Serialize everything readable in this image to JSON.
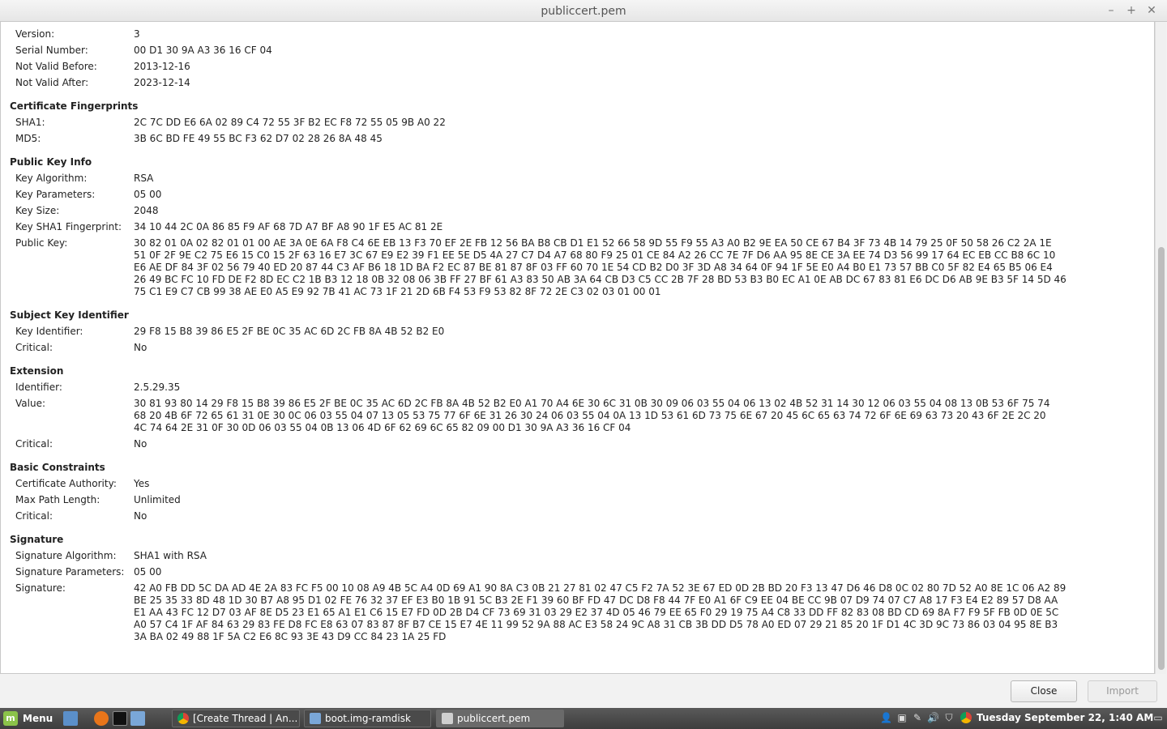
{
  "window": {
    "title": "publiccert.pem"
  },
  "cert": {
    "version_label": "Version:",
    "version": "3",
    "serial_label": "Serial Number:",
    "serial": "00 D1 30 9A A3 36 16 CF 04",
    "not_before_label": "Not Valid Before:",
    "not_before": "2013-12-16",
    "not_after_label": "Not Valid After:",
    "not_after": "2023-12-14",
    "fingerprints_header": "Certificate Fingerprints",
    "sha1_label": "SHA1:",
    "sha1": "2C 7C DD E6 6A 02 89 C4 72 55 3F B2 EC F8 72 55 05 9B A0 22",
    "md5_label": "MD5:",
    "md5": "3B 6C BD FE 49 55 BC F3 62 D7 02 28 26 8A 48 45",
    "pubkey_header": "Public Key Info",
    "key_alg_label": "Key Algorithm:",
    "key_alg": "RSA",
    "key_params_label": "Key Parameters:",
    "key_params": "05 00",
    "key_size_label": "Key Size:",
    "key_size": "2048",
    "key_sha1_label": "Key SHA1 Fingerprint:",
    "key_sha1": "34 10 44 2C 0A 86 85 F9 AF 68 7D A7 BF A8 90 1F E5 AC 81 2E",
    "public_key_label": "Public Key:",
    "public_key": "30 82 01 0A 02 82 01 01 00 AE 3A 0E 6A F8 C4 6E EB 13 F3 70 EF 2E FB 12 56 BA B8 CB D1 E1 52 66 58 9D 55 F9 55 A3 A0 B2 9E EA 50 CE 67 B4 3F 73 4B 14 79 25 0F 50 58 26 C2 2A 1E\n51 0F 2F 9E C2 75 E6 15 C0 15 2F 63 16 E7 3C 67 E9 E2 39 F1 EE 5E D5 4A 27 C7 D4 A7 68 80 F9 25 01 CE 84 A2 26 CC 7E 7F D6 AA 95 8E CE 3A EE 74 D3 56 99 17 64 EC EB CC B8 6C 10\nE6 AE DF 84 3F 02 56 79 40 ED 20 87 44 C3 AF B6 18 1D BA F2 EC 87 BE 81 87 8F 03 FF 60 70 1E 54 CD B2 D0 3F 3D A8 34 64 0F 94 1F 5E E0 A4 B0 E1 73 57 BB C0 5F 82 E4 65 B5 06 E4\n26 49 BC FC 10 FD DE F2 8D EC C2 1B B3 12 18 0B 32 08 06 3B FF 27 BF 61 A3 83 50 AB 3A 64 CB D3 C5 CC 2B 7F 28 BD 53 B3 B0 EC A1 0E AB DC 67 83 81 E6 DC D6 AB 9E B3 5F 14 5D 46\n75 C1 E9 C7 CB 99 38 AE E0 A5 E9 92 7B 41 AC 73 1F 21 2D 6B F4 53 F9 53 82 8F 72 2E C3 02 03 01 00 01",
    "ski_header": "Subject Key Identifier",
    "key_id_label": "Key Identifier:",
    "key_id": "29 F8 15 B8 39 86 E5 2F BE 0C 35 AC 6D 2C FB 8A 4B 52 B2 E0",
    "ski_critical_label": "Critical:",
    "ski_critical": "No",
    "ext_header": "Extension",
    "ext_id_label": "Identifier:",
    "ext_id": "2.5.29.35",
    "ext_value_label": "Value:",
    "ext_value": "30 81 93 80 14 29 F8 15 B8 39 86 E5 2F BE 0C 35 AC 6D 2C FB 8A 4B 52 B2 E0 A1 70 A4 6E 30 6C 31 0B 30 09 06 03 55 04 06 13 02 4B 52 31 14 30 12 06 03 55 04 08 13 0B 53 6F 75 74\n68 20 4B 6F 72 65 61 31 0E 30 0C 06 03 55 04 07 13 05 53 75 77 6F 6E 31 26 30 24 06 03 55 04 0A 13 1D 53 61 6D 73 75 6E 67 20 45 6C 65 63 74 72 6F 6E 69 63 73 20 43 6F 2E 2C 20\n4C 74 64 2E 31 0F 30 0D 06 03 55 04 0B 13 06 4D 6F 62 69 6C 65 82 09 00 D1 30 9A A3 36 16 CF 04",
    "ext_critical_label": "Critical:",
    "ext_critical": "No",
    "bc_header": "Basic Constraints",
    "ca_label": "Certificate Authority:",
    "ca": "Yes",
    "max_path_label": "Max Path Length:",
    "max_path": "Unlimited",
    "bc_critical_label": "Critical:",
    "bc_critical": "No",
    "sig_header": "Signature",
    "sig_alg_label": "Signature Algorithm:",
    "sig_alg": "SHA1 with RSA",
    "sig_params_label": "Signature Parameters:",
    "sig_params": "05 00",
    "sig_label": "Signature:",
    "signature": "42 A0 FB DD 5C DA AD 4E 2A 83 FC F5 00 10 08 A9 4B 5C A4 0D 69 A1 90 8A C3 0B 21 27 81 02 47 C5 F2 7A 52 3E 67 ED 0D 2B BD 20 F3 13 47 D6 46 D8 0C 02 80 7D 52 A0 8E 1C 06 A2 89\nBE 25 35 33 8D 48 1D 30 B7 A8 95 D1 02 FE 76 32 37 EF E3 B0 1B 91 5C B3 2E F1 39 60 BF FD 47 DC D8 F8 44 7F E0 A1 6F C9 EE 04 BE CC 9B 07 D9 74 07 C7 A8 17 F3 E4 E2 89 57 D8 AA\nE1 AA 43 FC 12 D7 03 AF 8E D5 23 E1 65 A1 E1 C6 15 E7 FD 0D 2B D4 CF 73 69 31 03 29 E2 37 4D 05 46 79 EE 65 F0 29 19 75 A4 C8 33 DD FF 82 83 08 BD CD 69 8A F7 F9 5F FB 0D 0E 5C\nA0 57 C4 1F AF 84 63 29 83 FE D8 FC E8 63 07 83 87 8F B7 CE 15 E7 4E 11 99 52 9A 88 AC E3 58 24 9C A8 31 CB 3B DD D5 78 A0 ED 07 29 21 85 20 1F D1 4C 3D 9C 73 86 03 04 95 8E B3\n3A BA 02 49 88 1F 5A C2 E6 8C 93 3E 43 D9 CC 84 23 1A 25 FD"
  },
  "buttons": {
    "close": "Close",
    "import": "Import"
  },
  "taskbar": {
    "menu_label": "Menu",
    "tasks": [
      {
        "label": "[Create Thread | An..."
      },
      {
        "label": "boot.img-ramdisk"
      },
      {
        "label": "publiccert.pem"
      }
    ],
    "clock": "Tuesday September 22,  1:40 AM"
  },
  "colors": {
    "accent_chrome": "#e0a000",
    "mint_green": "#8bc34a"
  },
  "icons": {
    "minimize": "minimize-icon",
    "maximize": "maximize-icon",
    "close": "close-icon"
  }
}
